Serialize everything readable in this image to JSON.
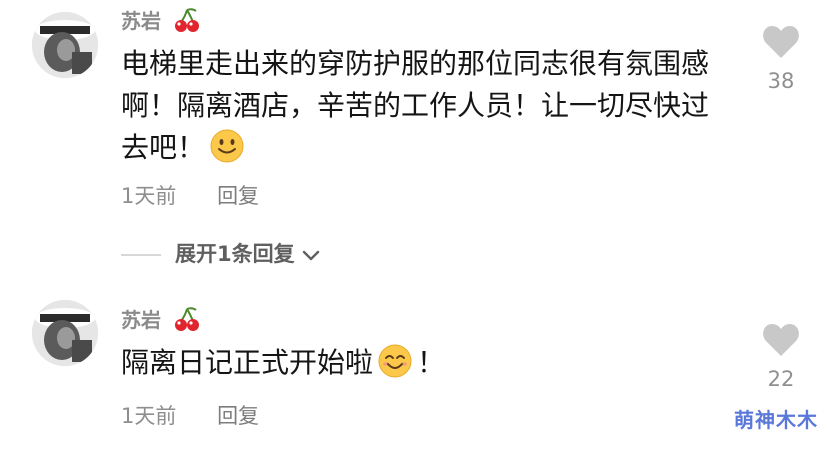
{
  "comments": [
    {
      "username": "苏岩",
      "content": "电梯里走出来的穿防护服的那位同志很有氛围感啊！隔离酒店，辛苦的工作人员！让一切尽快过去吧！",
      "emoji": "smile-emoji",
      "time": "1天前",
      "reply_label": "回复",
      "likes": "38"
    },
    {
      "username": "苏岩",
      "content": "隔离日记正式开始啦",
      "emoji": "happy-emoji",
      "content_suffix": "！",
      "time": "1天前",
      "reply_label": "回复",
      "likes": "22"
    }
  ],
  "expand_replies": "展开1条回复",
  "watermark": "萌神木木",
  "colors": {
    "heart": "#c8c8c8",
    "emoji_face": "#fbc84a",
    "cherry": "#e0252e",
    "watermark": "#5a78d8"
  }
}
